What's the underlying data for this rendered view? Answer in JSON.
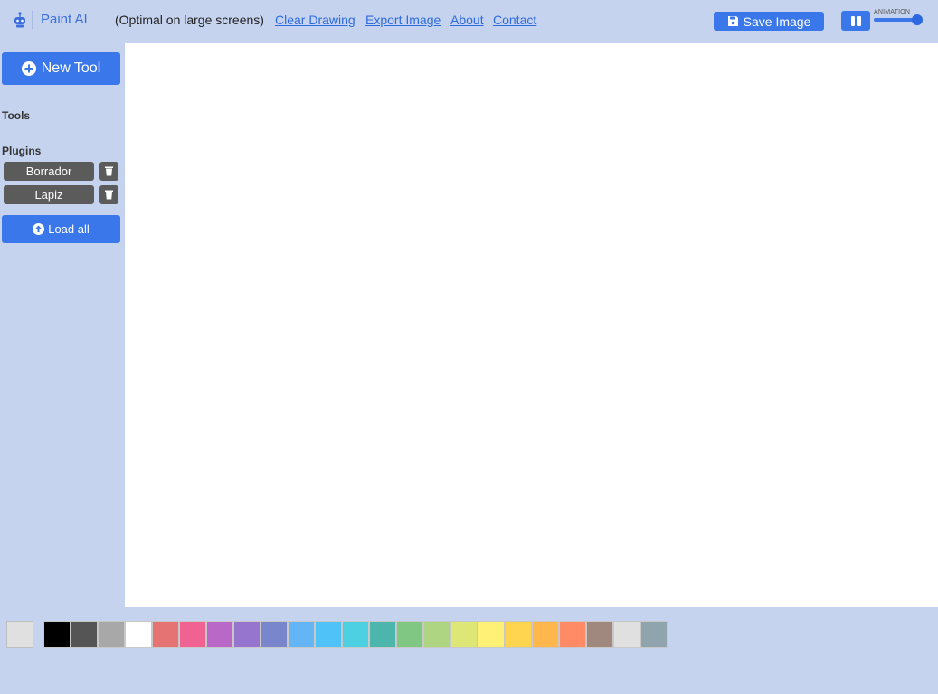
{
  "header": {
    "brand_name": "Paint AI",
    "tagline": "(Optimal on large screens)",
    "links": {
      "clear": "Clear Drawing",
      "export": "Export Image",
      "about": "About",
      "contact": "Contact"
    },
    "save_label": "Save Image",
    "animation_label": "ANIMATION",
    "animation_level": 1.0
  },
  "sidebar": {
    "new_tool_label": "New Tool",
    "tools_label": "Tools",
    "plugins_label": "Plugins",
    "plugins": [
      {
        "name": "Borrador"
      },
      {
        "name": "Lapiz"
      }
    ],
    "load_all_label": "Load all"
  },
  "palette": {
    "current": "#e0e0e0",
    "colors": [
      "#000000",
      "#555555",
      "#a8a8a8",
      "#ffffff",
      "#e57373",
      "#f06292",
      "#ba68c8",
      "#9575cd",
      "#7986cb",
      "#64b5f6",
      "#4fc3f7",
      "#4dd0e1",
      "#4db6ac",
      "#81c784",
      "#aed581",
      "#dce775",
      "#fff176",
      "#ffd54f",
      "#ffb74d",
      "#ff8a65",
      "#a1887f",
      "#e0e0e0",
      "#90a4ae"
    ]
  },
  "icons": {
    "logo": "robot-icon",
    "save": "floppy-disk-icon",
    "pause": "pause-icon",
    "new_tool": "plus-circle-icon",
    "delete": "trash-icon",
    "load_all": "arrow-up-circle-icon"
  },
  "colors": {
    "background": "#c5d3ee",
    "accent": "#3977ea",
    "plugin_button": "#5b5b5b",
    "link": "#2f6bdc"
  }
}
